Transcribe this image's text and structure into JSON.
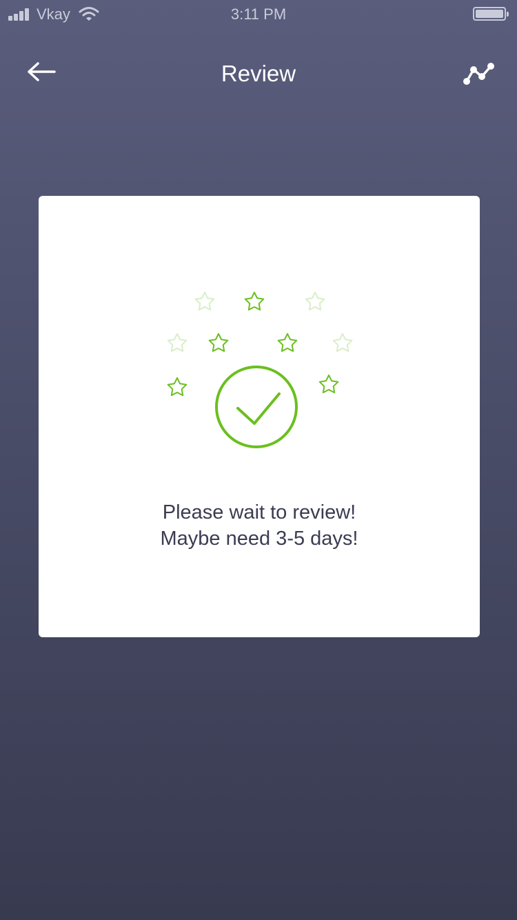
{
  "status_bar": {
    "carrier": "Vkay",
    "time": "3:11 PM",
    "signal_bars": 4
  },
  "header": {
    "title": "Review",
    "back_icon": "arrow-left-icon",
    "action_icon": "line-graph-icon"
  },
  "card": {
    "status_icon": "check-circle-icon",
    "line1": "Please wait to review!",
    "line2": "Maybe need 3-5 days!"
  },
  "colors": {
    "accent": "#6bbf1f",
    "accent_faded": "#d9eec8",
    "text": "#3a3c52",
    "card": "#ffffff"
  }
}
